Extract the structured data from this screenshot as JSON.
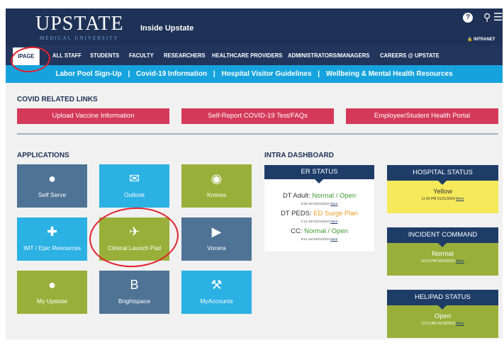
{
  "header": {
    "logo": "UPSTATE",
    "logo_sub": "MEDICAL UNIVERSITY",
    "title": "Inside Upstate",
    "intranet": "INTRANET",
    "icons": [
      "help-icon",
      "search-icon",
      "menu-icon",
      "lock-icon"
    ]
  },
  "nav": {
    "items": [
      "IPAGE",
      "ALL STAFF",
      "STUDENTS",
      "FACULTY",
      "RESEARCHERS",
      "HEALTHCARE PROVIDERS",
      "ADMINISTRATORS/MANAGERS",
      "CAREERS @ UPSTATE"
    ]
  },
  "subnav": {
    "links": [
      "Labor Pool Sign-Up",
      "Covid-19 Information",
      "Hospital Visitor Guidelines",
      "Wellbeing & Mental Health Resources"
    ],
    "separator": "|"
  },
  "covid": {
    "title": "COVID RELATED LINKS",
    "buttons": [
      "Upload Vaccine Information",
      "Self-Report COVID-19 Test/FAQs",
      "Employee/Student Health Portal"
    ]
  },
  "applications": {
    "title": "APPLICATIONS",
    "tiles": [
      {
        "label": "Self Serve",
        "icon": "person-icon"
      },
      {
        "label": "Outlook",
        "icon": "envelope-icon"
      },
      {
        "label": "Kronos",
        "icon": "kronos-icon"
      },
      {
        "label": "IMT / Epic Resources",
        "icon": "plus-icon"
      },
      {
        "label": "Clinical Launch Pad",
        "icon": "airplane-icon"
      },
      {
        "label": "Vocera",
        "icon": "megaphone-icon"
      },
      {
        "label": "My Upstate",
        "icon": "apple-icon"
      },
      {
        "label": "Brightspace",
        "icon": "brightspace-icon"
      },
      {
        "label": "MyAccounts",
        "icon": "wrench-icon"
      }
    ]
  },
  "dashboard": {
    "title": "INTRA DASHBOARD",
    "er": {
      "title": "ER STATUS",
      "rows": [
        {
          "label": "DT Adult: ",
          "value": "Normal / Open",
          "time": "5:59 AM 03/21/2024",
          "more": "More"
        },
        {
          "label": "DT PEDS: ",
          "value": "ED Surge Plan",
          "time": "2:14 AM 03/21/2024",
          "more": "More"
        },
        {
          "label": "CC: ",
          "value": "Normal / Open",
          "time": "8:51 AM 03/21/2024",
          "more": "More"
        }
      ]
    },
    "hospital": {
      "title": "HOSPITAL STATUS",
      "value": "Yellow",
      "time": "11:42 PM 01/21/2024",
      "more": "More",
      "color": "#f6ea5a"
    },
    "incident": {
      "title": "INCIDENT COMMAND",
      "value": "Normal",
      "time": "10:13 PM 03/20/2024",
      "more": "More",
      "color": "#9aaf3a"
    },
    "helipad": {
      "title": "HELIPAD STATUS",
      "value": "Open",
      "time": "12:13 AM 01/18/2024",
      "more": "More",
      "color": "#9aaf3a"
    }
  },
  "colors": {
    "navy": "#1e3156",
    "cyan": "#16a3dd",
    "red_button": "#d5395a",
    "steel_tile": "#4f7395",
    "cyan_tile": "#2bb1e3",
    "olive_tile": "#9aaf3a",
    "annotation_red": "#e3202c"
  }
}
